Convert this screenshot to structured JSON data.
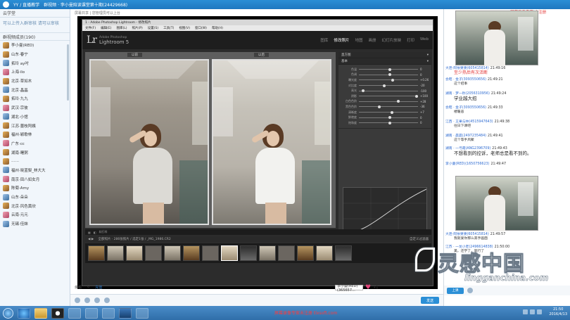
{
  "topbar": {
    "app_label": "YY / 直播教学",
    "group_title": "群视频 · 李小曼陪读课堂第十期(24429668)"
  },
  "sidebar": {
    "tab_label": "云学堂",
    "notice": "可以上传入群审核 请可以审核",
    "members_header": "群视频成员(190)",
    "members": [
      "李小曼(RED)",
      "山东·春宁",
      "拓玲 ay吋",
      "上海·ilo",
      "北京·草如木",
      "北京·晶晶",
      "拓玲·九九",
      "武汉·宗彼",
      "湖北·小馆",
      "江苏·蔓枝阿姨",
      "福州·颖歌林",
      "广东·cc",
      "湖南·曙粥",
      "……",
      "福州·晓蓝梨_林大大",
      "南京·田八如女月",
      "陈菊·Amy",
      "山东·朵朵",
      "北京·风色黄欣",
      "云南·元元",
      "无锡·佳妹"
    ]
  },
  "broadcast": {
    "crumb": "屏幕共享 | 您管理员可以上台",
    "lightroom": {
      "window_title": "1 - Adobe Photoshop Lightroom - 修改照片",
      "menu": [
        "文件(F)",
        "编辑(E)",
        "图库(L)",
        "照片(P)",
        "设置(S)",
        "工具(T)",
        "视图(V)",
        "窗口(W)",
        "帮助(H)"
      ],
      "logo_mark": "Lr",
      "logo_product": "Adobe Photoshop",
      "logo_name": "Lightroom 5",
      "modules": [
        "图库",
        "修改照片",
        "地图",
        "画册",
        "幻灯片放映",
        "打印",
        "Web"
      ],
      "active_module": "修改照片",
      "before_label": "以前",
      "after_label": "以后",
      "panel_title": "直方图",
      "panel_section": "基本",
      "sliders": [
        {
          "label": "色温",
          "value": "0",
          "pos": 0.5
        },
        {
          "label": "色调",
          "value": "0",
          "pos": 0.5
        },
        {
          "label": "曝光度",
          "value": "+0.26",
          "pos": 0.55
        },
        {
          "label": "对比度",
          "value": "-20",
          "pos": 0.4
        },
        {
          "label": "高光",
          "value": "-100",
          "pos": 0.05
        },
        {
          "label": "阴影",
          "value": "+100",
          "pos": 0.95
        },
        {
          "label": "白色色阶",
          "value": "+28",
          "pos": 0.64
        },
        {
          "label": "黑色色阶",
          "value": "-36",
          "pos": 0.32
        },
        {
          "label": "清晰度",
          "value": "+7",
          "pos": 0.53
        },
        {
          "label": "鲜艳度",
          "value": "0",
          "pos": 0.5
        },
        {
          "label": "饱和度",
          "value": "0",
          "pos": 0.5
        }
      ],
      "toolbar_label": "软打样",
      "filmstrip_info": "全部照片 · 286张照片 / 选定1张 / _MG_1986.CR2",
      "filmstrip_filter": "自定义过滤器",
      "thumbs": 14,
      "selected_thumb": 7
    },
    "presenter": "李小曼(RED)",
    "bottom": {
      "balance_label": "余额",
      "balance_value": "0",
      "recharge": "充值",
      "presenter_select": "李小曼(RED)(365657...",
      "likes": "+1",
      "send_label": "发送"
    }
  },
  "chat": {
    "watermark": "屏幕录像专家 未注册",
    "messages": [
      {
        "who": "大连-阿依婆婆(605415814)",
        "time": "21:49:16",
        "text": "至少热后有次活断",
        "style": "red"
      },
      {
        "who": "会昭 · 金子(3093550656)",
        "time": "21:49:21",
        "text": "这个招事",
        "style": "normal"
      },
      {
        "who": "湖南 · 梦一秒(2056310956)",
        "time": "21:49:24",
        "text": "学业越大招",
        "style": "big"
      },
      {
        "who": "会昭 · 金子(3093550656)",
        "time": "21:49:33",
        "text": "楼暖恶",
        "style": "normal"
      },
      {
        "who": "江西 · 王果与林(4515947643)",
        "time": "21:49:38",
        "text": "往日下课吧",
        "style": "normal"
      },
      {
        "who": "湖南 · 晨晨(2497235484)",
        "time": "21:49:41",
        "text": "这个等手风聚",
        "style": "normal"
      },
      {
        "who": "湖南 · 一弓霞(ANG2396709)",
        "time": "21:49:43",
        "text": "不想看到的控诉，老师总是看不到的。",
        "style": "big"
      },
      {
        "who": "李小曼(RED)(1650756623)",
        "time": "21:49:47",
        "text": "",
        "style": "normal"
      },
      {
        "who": "大连-阿依婆婆(605415814)",
        "time": "21:49:57",
        "text": "我就爱你那么高手画面",
        "style": "normal"
      },
      {
        "who": "江苏 · 一龙小老(2496614838)",
        "time": "21:50:00",
        "text": "美，还学了，就行了",
        "style": "normal"
      }
    ],
    "ctrl_button": "上课"
  },
  "site": {
    "logo_big": "灵感中国",
    "logo_small": "lingganchina.com"
  },
  "taskbar": {
    "tip": "屏幕录像专家未注册 tlxsoft.com",
    "clock_time": "21:50",
    "clock_date": "2016/4/13"
  },
  "colors": {
    "qq_blue": "#2b8fd6",
    "lr_dark": "#2c2c2c",
    "chat_red": "#e23535",
    "link_blue": "#2e6bd1"
  }
}
